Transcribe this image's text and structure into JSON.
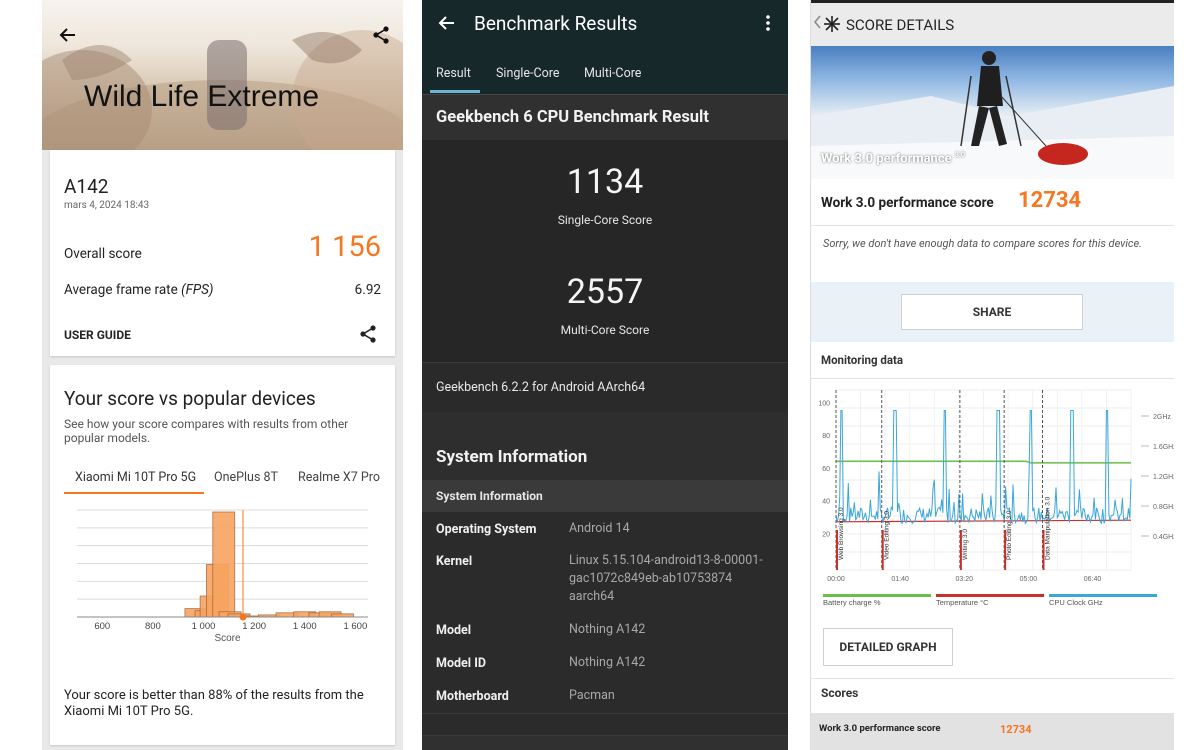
{
  "panel1": {
    "hero_title": "Wild Life Extreme",
    "device": "A142",
    "date": "mars 4, 2024 18:43",
    "overall_label": "Overall score",
    "overall_value": "1 156",
    "fps_label": "Average frame rate",
    "fps_unit": "(FPS)",
    "fps_value": "6.92",
    "user_guide": "USER GUIDE",
    "compare_title": "Your score vs popular devices",
    "compare_desc": "See how your score compares with results from other popular models.",
    "tabs": [
      "Xiaomi Mi 10T Pro 5G",
      "OnePlus 8T",
      "Realme X7 Pro"
    ],
    "chart_data": {
      "type": "area",
      "xlabel": "Score",
      "x_ticks": [
        "600",
        "800",
        "1 000",
        "1 200",
        "1 400",
        "1 600"
      ],
      "bins": [
        {
          "x": 970,
          "h": 8
        },
        {
          "x": 1010,
          "h": 6
        },
        {
          "x": 1030,
          "h": 20
        },
        {
          "x": 1055,
          "h": 50
        },
        {
          "x": 1080,
          "h": 100
        },
        {
          "x": 1105,
          "h": 5
        },
        {
          "x": 1140,
          "h": 3
        },
        {
          "x": 1190,
          "h": 1
        },
        {
          "x": 1260,
          "h": 2
        },
        {
          "x": 1330,
          "h": 4
        },
        {
          "x": 1400,
          "h": 5
        },
        {
          "x": 1460,
          "h": 4
        },
        {
          "x": 1500,
          "h": 5
        },
        {
          "x": 1550,
          "h": 3
        }
      ],
      "marker": 1156,
      "xlim": [
        500,
        1650
      ]
    },
    "result_text": "Your score is better than 88% of the results from the Xiaomi Mi 10T Pro 5G."
  },
  "panel2": {
    "title": "Benchmark Results",
    "tabs": [
      "Result",
      "Single-Core",
      "Multi-Core"
    ],
    "result_header": "Geekbench 6 CPU Benchmark Result",
    "single_score": "1134",
    "single_label": "Single-Core Score",
    "multi_score": "2557",
    "multi_label": "Multi-Core Score",
    "version": "Geekbench 6.2.2 for Android AArch64",
    "sysinfo_title": "System Information",
    "sysinfo_sub": "System Information",
    "rows": [
      {
        "k": "Operating System",
        "v": "Android 14"
      },
      {
        "k": "Kernel",
        "v": "Linux 5.15.104-android13-8-00001-gac1072c849eb-ab10753874 aarch64"
      },
      {
        "k": "Model",
        "v": "Nothing A142"
      },
      {
        "k": "Model ID",
        "v": "Nothing A142"
      },
      {
        "k": "Motherboard",
        "v": "Pacman"
      }
    ]
  },
  "panel3": {
    "header": "SCORE DETAILS",
    "photo_caption": "Work 3.0 performance",
    "photo_caption_sup": "3.0",
    "score_label": "Work 3.0 performance score",
    "score_value": "12734",
    "sorry_text": "Sorry, we don't have enough data to compare scores for this device.",
    "share": "SHARE",
    "monitoring": "Monitoring data",
    "chart_data": {
      "type": "line",
      "y_ticks": [
        "100",
        "80",
        "60",
        "40",
        "20"
      ],
      "y2_ticks": [
        "2GHz",
        "1.6GHz",
        "1.2GHz",
        "0.8GHz",
        "0.4GHz"
      ],
      "x_ticks": [
        "00:00",
        "01:40",
        "03:20",
        "05:00",
        "06:40"
      ],
      "markers": [
        "Web Browsing 3.0",
        "Video Editing 3.0",
        "Writing 3.0",
        "Photo Editing 3.0",
        "Data Manipulation 3.0"
      ],
      "legend": [
        "Battery charge %",
        "Temperature °C",
        "CPU Clock GHz"
      ]
    },
    "detailed_graph": "DETAILED GRAPH",
    "scores_title": "Scores",
    "scores_row_label": "Work 3.0 performance score",
    "scores_row_value": "12734",
    "colors": {
      "battery": "#6dbf4b",
      "temperature": "#c9302c",
      "cpu": "#3ba7d9",
      "accent": "#f57722"
    }
  }
}
